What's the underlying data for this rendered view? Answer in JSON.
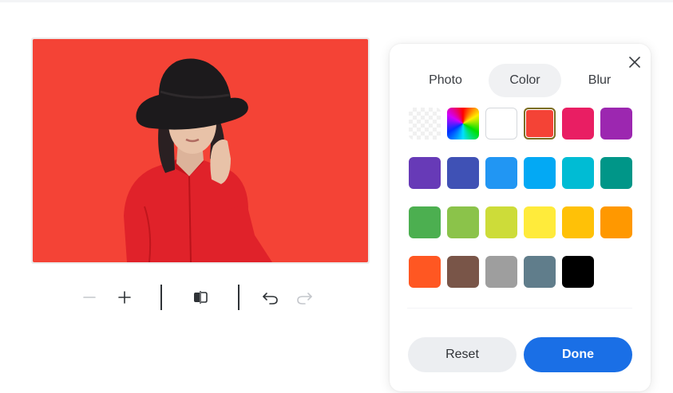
{
  "tabs": [
    {
      "label": "Photo",
      "active": false
    },
    {
      "label": "Color",
      "active": true
    },
    {
      "label": "Blur",
      "active": false
    }
  ],
  "swatches": [
    {
      "name": "transparent",
      "color": "transparent",
      "selected": false
    },
    {
      "name": "rainbow",
      "color": "rainbow",
      "selected": false
    },
    {
      "name": "white",
      "color": "#ffffff",
      "selected": false
    },
    {
      "name": "red",
      "color": "#f44336",
      "selected": true
    },
    {
      "name": "pink",
      "color": "#e91e63",
      "selected": false
    },
    {
      "name": "purple",
      "color": "#9c27b0",
      "selected": false
    },
    {
      "name": "deep-purple",
      "color": "#673ab7",
      "selected": false
    },
    {
      "name": "indigo",
      "color": "#3f51b5",
      "selected": false
    },
    {
      "name": "blue",
      "color": "#2196f3",
      "selected": false
    },
    {
      "name": "light-blue",
      "color": "#03a9f4",
      "selected": false
    },
    {
      "name": "cyan",
      "color": "#00bcd4",
      "selected": false
    },
    {
      "name": "teal",
      "color": "#009688",
      "selected": false
    },
    {
      "name": "green",
      "color": "#4caf50",
      "selected": false
    },
    {
      "name": "light-green",
      "color": "#8bc34a",
      "selected": false
    },
    {
      "name": "lime",
      "color": "#cddc39",
      "selected": false
    },
    {
      "name": "yellow",
      "color": "#ffeb3b",
      "selected": false
    },
    {
      "name": "amber",
      "color": "#ffc107",
      "selected": false
    },
    {
      "name": "orange",
      "color": "#ff9800",
      "selected": false
    },
    {
      "name": "deep-orange",
      "color": "#ff5722",
      "selected": false
    },
    {
      "name": "brown",
      "color": "#795548",
      "selected": false
    },
    {
      "name": "grey",
      "color": "#9e9e9e",
      "selected": false
    },
    {
      "name": "blue-grey",
      "color": "#607d8b",
      "selected": false
    },
    {
      "name": "black",
      "color": "#000000",
      "selected": false
    }
  ],
  "buttons": {
    "reset": "Reset",
    "done": "Done"
  },
  "photo": {
    "background_color": "#f44336"
  },
  "toolbar": {
    "icons": [
      "zoom-out-icon",
      "zoom-in-icon",
      "compare-icon",
      "undo-icon",
      "redo-icon"
    ],
    "zoom_out_enabled": false,
    "redo_enabled": false
  },
  "colors": {
    "accent": "#1a6fe6",
    "reset_bg": "#eceef1",
    "tab_active_bg": "#f0f1f3"
  }
}
